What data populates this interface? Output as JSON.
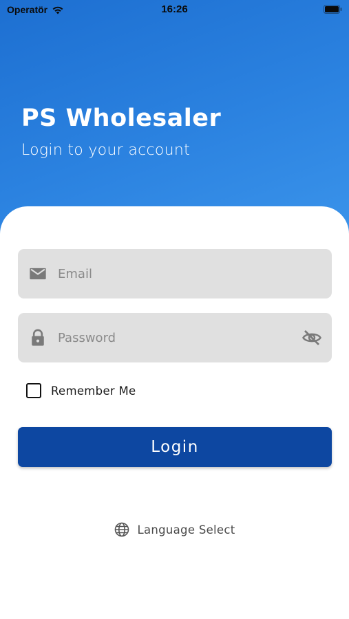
{
  "status_bar": {
    "carrier": "Operatör",
    "time": "16:26",
    "wifi_icon": "wifi-icon",
    "battery_icon": "battery-icon"
  },
  "header": {
    "title": "PS Wholesaler",
    "subtitle": "Login to your account",
    "gradient_colors": [
      "#1d6fd1",
      "#3a93ea"
    ]
  },
  "form": {
    "email": {
      "placeholder": "Email",
      "value": "",
      "icon": "mail-icon"
    },
    "password": {
      "placeholder": "Password",
      "value": "",
      "icon": "lock-icon",
      "toggle_icon": "eye-off-icon"
    },
    "remember_me": {
      "label": "Remember Me",
      "checked": false
    },
    "login_button": {
      "label": "Login",
      "color": "#0d47a1"
    }
  },
  "language": {
    "label": "Language Select",
    "icon": "globe-icon"
  }
}
